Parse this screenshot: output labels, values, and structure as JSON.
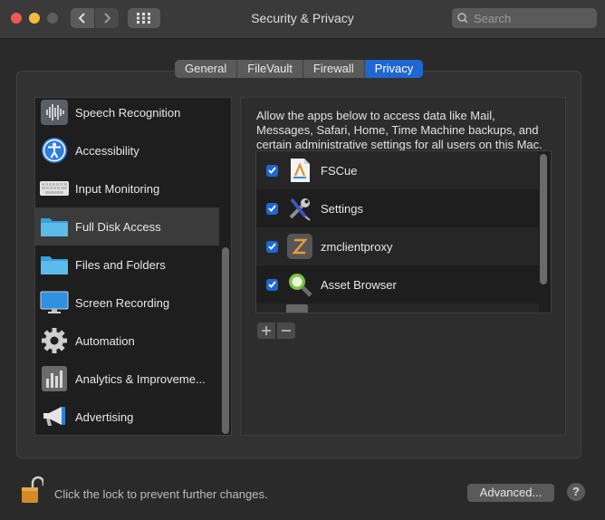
{
  "window": {
    "title": "Security & Privacy"
  },
  "search": {
    "placeholder": "Search"
  },
  "tabs": [
    {
      "label": "General",
      "active": false
    },
    {
      "label": "FileVault",
      "active": false
    },
    {
      "label": "Firewall",
      "active": false
    },
    {
      "label": "Privacy",
      "active": true
    }
  ],
  "sidebar": {
    "items": [
      {
        "label": "Speech Recognition",
        "icon": "waveform-icon"
      },
      {
        "label": "Accessibility",
        "icon": "accessibility-icon"
      },
      {
        "label": "Input Monitoring",
        "icon": "keyboard-icon"
      },
      {
        "label": "Full Disk Access",
        "icon": "folder-icon",
        "selected": true
      },
      {
        "label": "Files and Folders",
        "icon": "folder-icon"
      },
      {
        "label": "Screen Recording",
        "icon": "display-icon"
      },
      {
        "label": "Automation",
        "icon": "gear-icon"
      },
      {
        "label": "Analytics & Improveme...",
        "icon": "bar-chart-icon"
      },
      {
        "label": "Advertising",
        "icon": "megaphone-icon"
      }
    ]
  },
  "description": "Allow the apps below to access data like Mail, Messages, Safari, Home, Time Machine backups, and certain administrative settings for all users on this Mac.",
  "apps": [
    {
      "name": "FSCue",
      "checked": true,
      "icon": "fscue-app-icon"
    },
    {
      "name": "Settings",
      "checked": true,
      "icon": "wrench-screwdriver-icon"
    },
    {
      "name": "zmclientproxy",
      "checked": true,
      "icon": "zm-app-icon"
    },
    {
      "name": "Asset Browser",
      "checked": true,
      "icon": "magnifier-icon"
    }
  ],
  "footer": {
    "lock_message": "Click the lock to prevent further changes.",
    "advanced_label": "Advanced...",
    "help_label": "?"
  },
  "colors": {
    "accent": "#1f67d2",
    "background": "#2a2a2a"
  }
}
